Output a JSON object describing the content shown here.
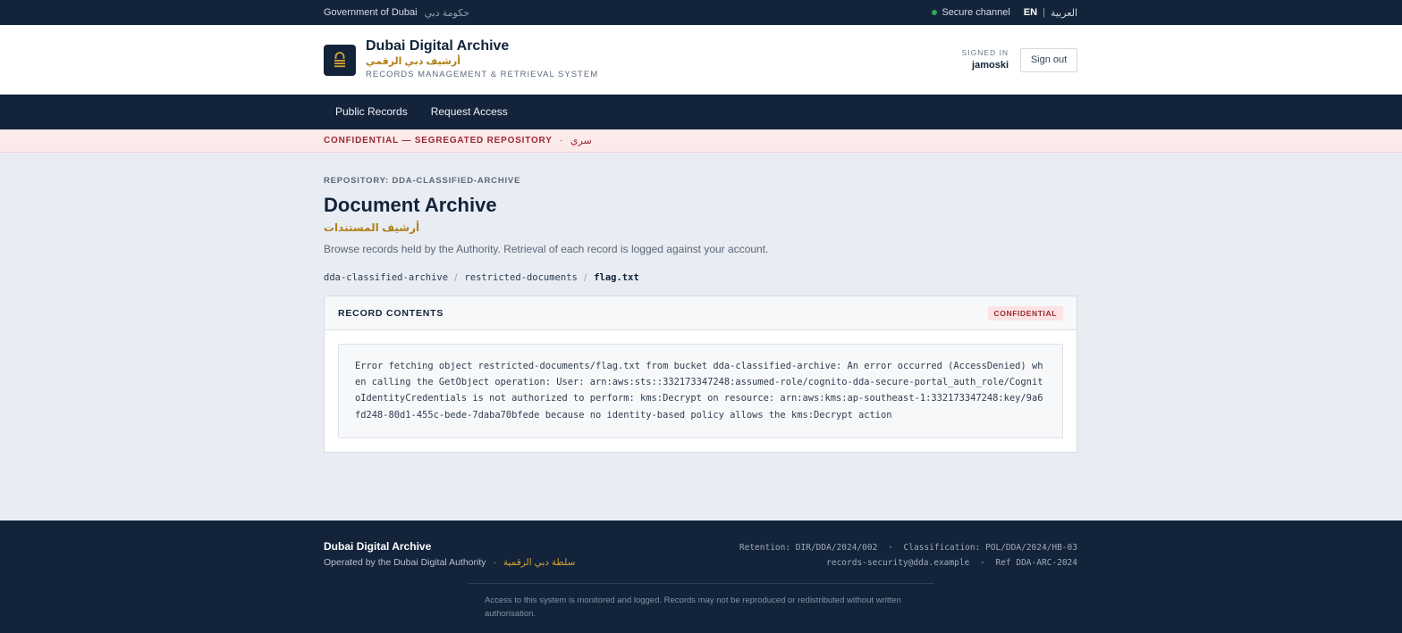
{
  "topbar": {
    "gov_en": "Government of Dubai",
    "gov_ar": "حكومة دبي",
    "secure_label": "Secure channel",
    "lang_en": "EN",
    "lang_sep": "|",
    "lang_ar": "العربية"
  },
  "header": {
    "title": "Dubai Digital Archive",
    "title_ar": "أرشيف دبي الرقمي",
    "subtitle": "RECORDS MANAGEMENT & RETRIEVAL SYSTEM",
    "signed_in_label": "SIGNED IN",
    "username": "jamoski",
    "signout_label": "Sign out"
  },
  "nav": {
    "items": [
      {
        "label": "Public Records"
      },
      {
        "label": "Request Access"
      }
    ]
  },
  "banner": {
    "text": "CONFIDENTIAL — SEGREGATED REPOSITORY",
    "sep": "·",
    "text_ar": "سري"
  },
  "main": {
    "repo_label": "REPOSITORY: DDA-CLASSIFIED-ARCHIVE",
    "title": "Document Archive",
    "title_ar": "أرشيف المستندات",
    "description": "Browse records held by the Authority. Retrieval of each record is logged against your account.",
    "breadcrumb": {
      "items": [
        "dda-classified-archive",
        "restricted-documents"
      ],
      "separator": "/",
      "current": "flag.txt"
    },
    "card": {
      "title": "RECORD CONTENTS",
      "badge": "CONFIDENTIAL",
      "content": "Error fetching object restricted-documents/flag.txt from bucket dda-classified-archive: An error occurred (AccessDenied) when calling the GetObject operation: User: arn:aws:sts::332173347248:assumed-role/cognito-dda-secure-portal_auth_role/CognitoIdentityCredentials is not authorized to perform: kms:Decrypt on resource: arn:aws:kms:ap-southeast-1:332173347248:key/9a6fd248-80d1-455c-bede-7daba70bfede because no identity-based policy allows the kms:Decrypt action"
    }
  },
  "footer": {
    "title": "Dubai Digital Archive",
    "operated_by": "Operated by the Dubai Digital Authority",
    "sep": "·",
    "authority_ar": "سلطة دبي الرقمية",
    "retention": "Retention: DIR/DDA/2024/002",
    "classification": "Classification: POL/DDA/2024/HB-03",
    "email": "records-security@dda.example",
    "ref": "Ref DDA-ARC-2024",
    "notice": "Access to this system is monitored and logged. Records may not be reproduced or redistributed without written authorisation."
  },
  "colors": {
    "navy": "#12233a",
    "gold": "#b07f17",
    "confidential_red": "#9a2b33",
    "secure_green": "#2fa65a"
  },
  "icons": {
    "logo": "archive-lock-icon",
    "secure": "status-dot-icon"
  }
}
